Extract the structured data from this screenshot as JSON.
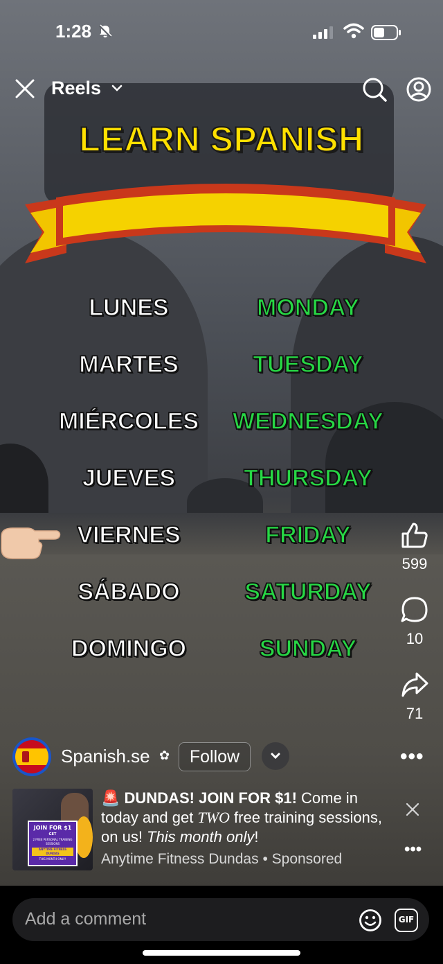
{
  "status_bar": {
    "time": "1:28"
  },
  "header": {
    "title": "Reels"
  },
  "video": {
    "title": "LEARN SPANISH",
    "rows": [
      {
        "es": "LUNES",
        "en": "MONDAY"
      },
      {
        "es": "MARTES",
        "en": "TUESDAY"
      },
      {
        "es": "MIÉRCOLES",
        "en": "WEDNESDAY"
      },
      {
        "es": "JUEVES",
        "en": "THURSDAY"
      },
      {
        "es": "VIERNES",
        "en": "FRIDAY"
      },
      {
        "es": "SÁBADO",
        "en": "SATURDAY"
      },
      {
        "es": "DOMINGO",
        "en": "SUNDAY"
      }
    ],
    "highlighted_row": 4
  },
  "actions": {
    "likes": "599",
    "comments": "10",
    "shares": "71"
  },
  "author": {
    "name": "Spanish.se",
    "follow_label": "Follow"
  },
  "ad": {
    "emoji": "🚨",
    "headline": "DUNDAS!  JOIN FOR $1!",
    "line1_rest": " Come in today and get ",
    "two": "TWO",
    "line2_rest": " free training sessions, on us! ",
    "this_month": "This month only",
    "bang": "!",
    "advertiser": "Anytime Fitness Dundas",
    "sep": " • ",
    "sponsored": "Sponsored",
    "thumb_join": "JOIN FOR $1",
    "thumb_get": "GET",
    "thumb_offer": "2 FREE PERSONAL TRAINING SESSIONS",
    "thumb_brand": "ANYTIME FITNESS DUNDAS",
    "thumb_month": "THIS MONTH ONLY!"
  },
  "comment": {
    "placeholder": "Add a comment",
    "gif_label": "GIF"
  },
  "colors": {
    "title_yellow": "#ffe000",
    "english_green": "#27d845",
    "ribbon_red": "#c9381b"
  }
}
